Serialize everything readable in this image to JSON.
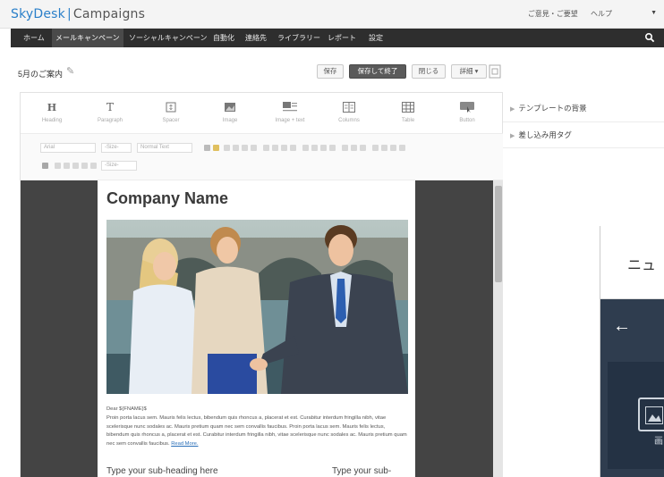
{
  "app": {
    "brand": "SkyDesk",
    "separator": "|",
    "product": "Campaigns"
  },
  "top_links": {
    "feedback": "ご意見・ご要望",
    "help": "ヘルプ"
  },
  "nav": {
    "items": [
      "ホーム",
      "メールキャンペーン",
      "ソーシャルキャンペーン",
      "自動化",
      "連絡先",
      "ライブラリー",
      "レポート",
      "設定"
    ],
    "active_index": 1
  },
  "campaign": {
    "title": "5月のご案内"
  },
  "toolbar": {
    "save": "保存",
    "save_and_finish": "保存して終了",
    "close": "閉じる",
    "details": "詳細"
  },
  "blocks": [
    {
      "label": "Heading",
      "icon": "heading-icon",
      "glyph": "H"
    },
    {
      "label": "Paragraph",
      "icon": "paragraph-icon",
      "glyph": "T"
    },
    {
      "label": "Spacer",
      "icon": "spacer-icon",
      "glyph": "↕"
    },
    {
      "label": "Image",
      "icon": "image-icon",
      "glyph": ""
    },
    {
      "label": "Image + text",
      "icon": "image-text-icon",
      "glyph": ""
    },
    {
      "label": "Columns",
      "icon": "columns-icon",
      "glyph": ""
    },
    {
      "label": "Table",
      "icon": "table-icon",
      "glyph": ""
    },
    {
      "label": "Button",
      "icon": "button-icon",
      "glyph": ""
    }
  ],
  "format": {
    "font": "Arial",
    "size": "-Size-",
    "style": "Normal Text",
    "size2": "-Size-"
  },
  "email": {
    "company": "Company Name",
    "greeting": "Dear ${FNAME}$",
    "body": "Proin porta lacus sem. Mauris felis lectus, bibendum quis rhoncus a, placerat et est. Curabitur interdum fringilla nibh, vitae scelerisque nunc sodales ac. Mauris pretium quam nec sem convallis faucibus. Proin porta lacus sem. Mauris felis lectus, bibendum quis rhoncus a, placerat et est. Curabitur interdum fringilla nibh, vitae scelerisque nunc sodales ac. Mauris pretium quam nec sem convallis faucibus.",
    "read_more": "Read More.",
    "subheading_left": "Type your sub-heading here",
    "subheading_right": "Type your sub-"
  },
  "right_panel": {
    "template_background": "テンプレートの背景",
    "merge_tags": "差し込み用タグ"
  },
  "phone_preview": {
    "header_text": "ニュ",
    "image_caption": "画"
  },
  "colors": {
    "brand_blue": "#2a7fc9",
    "nav_bg": "#2e2e2e",
    "canvas_bg": "#444444",
    "phone_dark": "#2f3d4f"
  }
}
